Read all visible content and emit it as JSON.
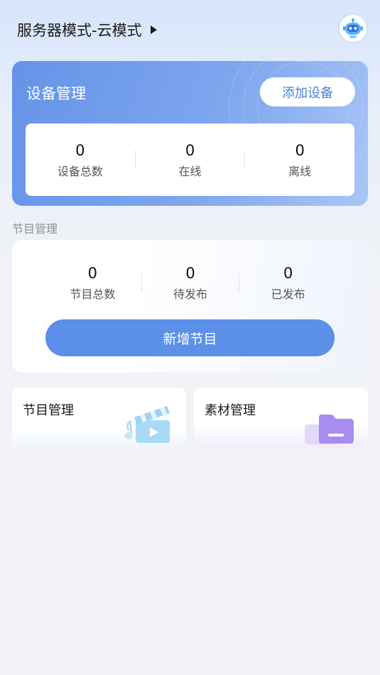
{
  "header": {
    "mode_title": "服务器模式-云模式"
  },
  "device": {
    "title": "设备管理",
    "add_button": "添加设备",
    "stats": [
      {
        "value": "0",
        "label": "设备总数"
      },
      {
        "value": "0",
        "label": "在线"
      },
      {
        "value": "0",
        "label": "离线"
      }
    ]
  },
  "program": {
    "section_label": "节目管理",
    "stats": [
      {
        "value": "0",
        "label": "节目总数"
      },
      {
        "value": "0",
        "label": "待发布"
      },
      {
        "value": "0",
        "label": "已发布"
      }
    ],
    "new_button": "新增节目"
  },
  "tiles": [
    {
      "label": "节目管理",
      "icon": "clapperboard-icon"
    },
    {
      "label": "素材管理",
      "icon": "folder-icon"
    }
  ],
  "colors": {
    "accent": "#5b8fe8",
    "card_gradient_start": "#6593e8",
    "page_bg": "#f1f3f6"
  }
}
